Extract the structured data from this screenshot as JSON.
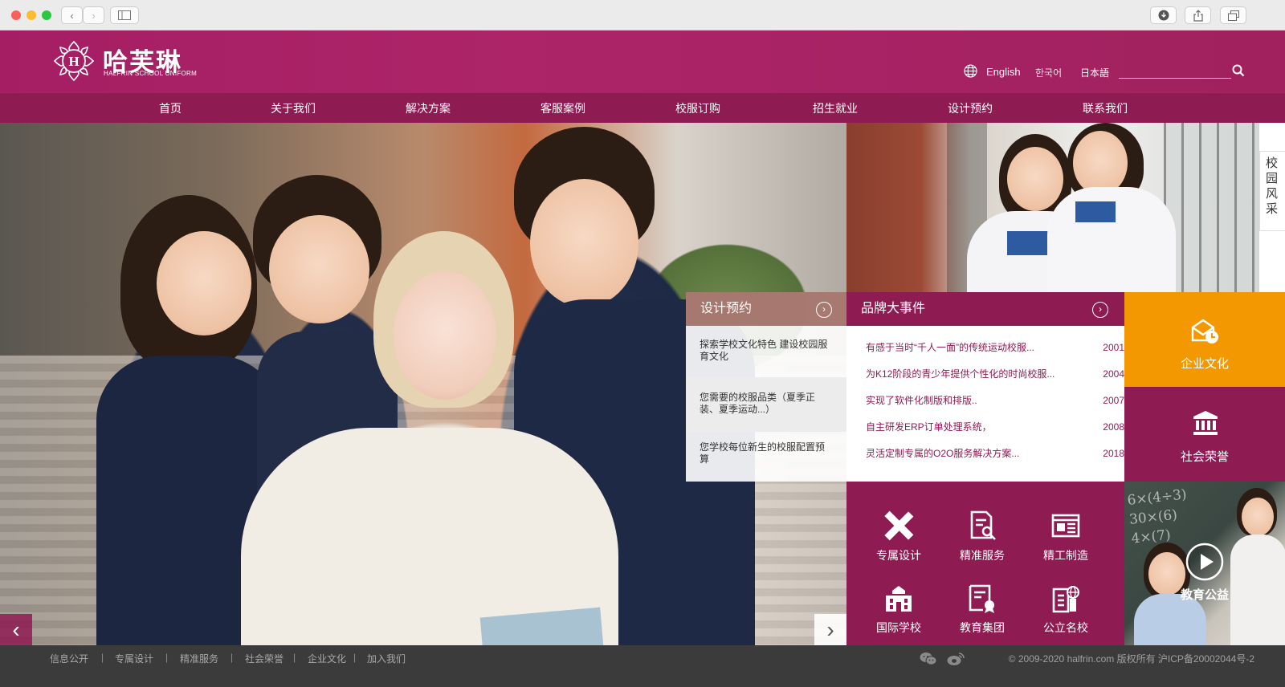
{
  "browser": {
    "back_icon": "chevron-left-icon",
    "forward_icon": "chevron-right-icon",
    "sidebar_icon": "sidebar-icon",
    "download_icon": "download-icon",
    "share_icon": "share-icon",
    "tabs_icon": "tabs-icon"
  },
  "brand": {
    "name_cn": "哈芙琳",
    "name_en": "HALFRIN SCHOOL UNIFORM",
    "mark_letter": "H",
    "color": "#a51e63",
    "nav_color": "#8e1b52",
    "orange": "#f39800"
  },
  "languages": [
    "English",
    "한국어",
    "日本語"
  ],
  "search": {
    "placeholder": ""
  },
  "nav": [
    "首页",
    "关于我们",
    "解决方案",
    "客服案例",
    "校服订购",
    "招生就业",
    "设计预约",
    "联系我们"
  ],
  "side_tab": "校园风采",
  "design_card": {
    "title": "设计预约",
    "items": [
      "探索学校文化特色 建设校园服育文化",
      "您需要的校服品类（夏季正装、夏季运动...）",
      "您学校每位新生的校服配置预算"
    ]
  },
  "events_card": {
    "title": "品牌大事件",
    "items": [
      {
        "text": "有感于当时“千人一面”的传统运动校服...",
        "year": "2001"
      },
      {
        "text": "为K12阶段的青少年提供个性化的时尚校服...",
        "year": "2004"
      },
      {
        "text": "实现了软件化制版和排版..",
        "year": "2007"
      },
      {
        "text": "自主研发ERP订单处理系统，",
        "year": "2008"
      },
      {
        "text": "灵活定制专属的O2O服务解决方案...",
        "year": "2018"
      }
    ]
  },
  "tiles": {
    "culture": "企业文化",
    "honor": "社会荣誉",
    "education": "教育公益"
  },
  "services": [
    "专属设计",
    "精准服务",
    "精工制造",
    "国际学校",
    "教育集团",
    "公立名校"
  ],
  "footer": {
    "links": [
      "信息公开",
      "专属设计",
      "精准服务",
      "社会荣誉",
      "企业文化",
      "加入我们"
    ],
    "copyright": "© 2009-2020 halfrin.com 版权所有 沪ICP备20002044号-2"
  }
}
